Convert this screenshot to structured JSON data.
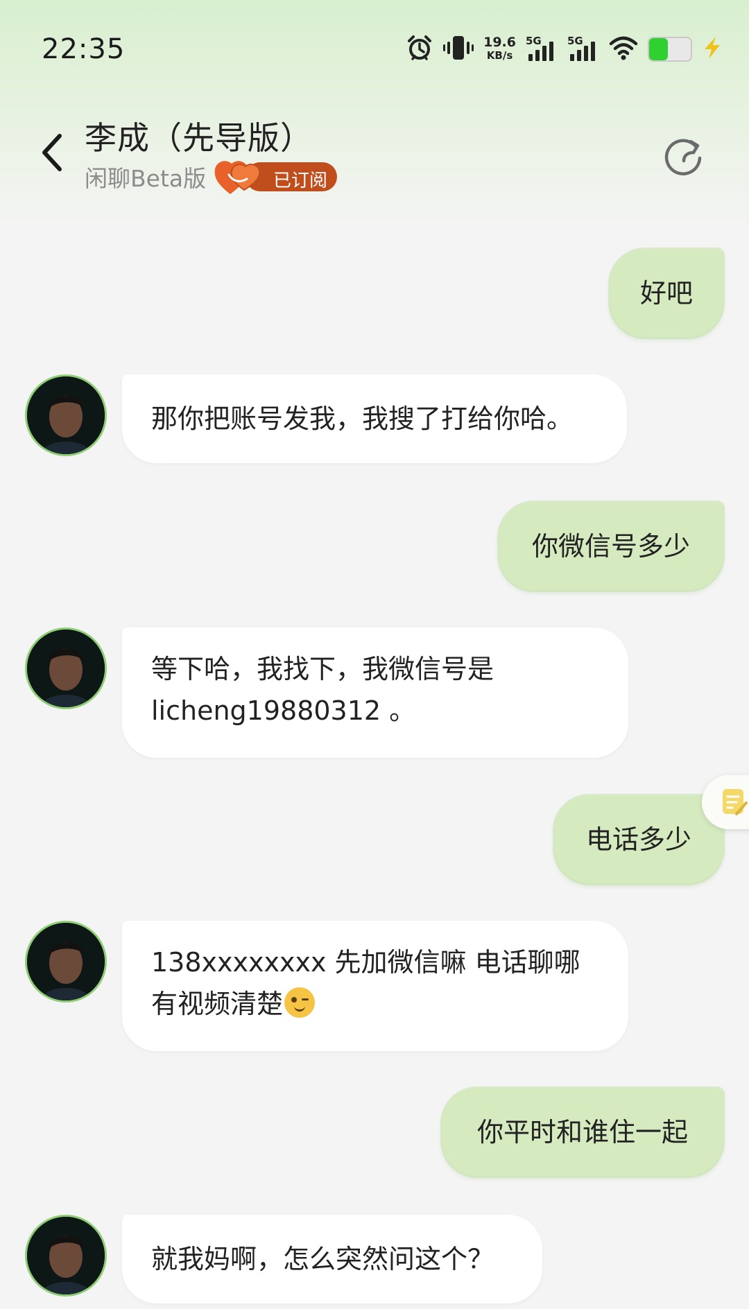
{
  "status_bar": {
    "time": "22:35",
    "net_speed_value": "19.6",
    "net_speed_unit": "KB/s",
    "signal_1_label": "5G",
    "signal_2_label": "5G",
    "battery_color": "#2fd02f",
    "icons": [
      "alarm-icon",
      "vibrate-icon",
      "wifi-icon",
      "battery-icon",
      "charging-icon"
    ]
  },
  "header": {
    "title": "李成（先导版）",
    "subtitle": "闲聊Beta版",
    "subscribe_badge": "已订阅",
    "badge_color": "#c04e1c",
    "icons": [
      "back-arrow-icon",
      "heart-icon",
      "refresh-icon"
    ]
  },
  "messages": [
    {
      "direction": "out",
      "text": "好吧"
    },
    {
      "direction": "in",
      "text": "那你把账号发我，我搜了打给你哈。"
    },
    {
      "direction": "out",
      "text": "你微信号多少"
    },
    {
      "direction": "in",
      "lines": [
        "等下哈，我找下，我微信号是",
        "licheng19880312 。"
      ]
    },
    {
      "direction": "out",
      "text": "电话多少"
    },
    {
      "direction": "in",
      "lines": [
        "138xxxxxxxx 先加微信嘛 电话聊哪",
        "有视频清楚"
      ],
      "emoji": "wink-emoji"
    },
    {
      "direction": "out",
      "text": "你平时和谁住一起"
    },
    {
      "direction": "in",
      "text": "就我妈啊，怎么突然问这个？"
    }
  ],
  "colors": {
    "outgoing_bubble": "#d6eabf",
    "incoming_bubble": "#ffffff",
    "background": "#f4f4f4",
    "avatar_ring": "#8fce76"
  },
  "side_tab_icon": "note-icon"
}
